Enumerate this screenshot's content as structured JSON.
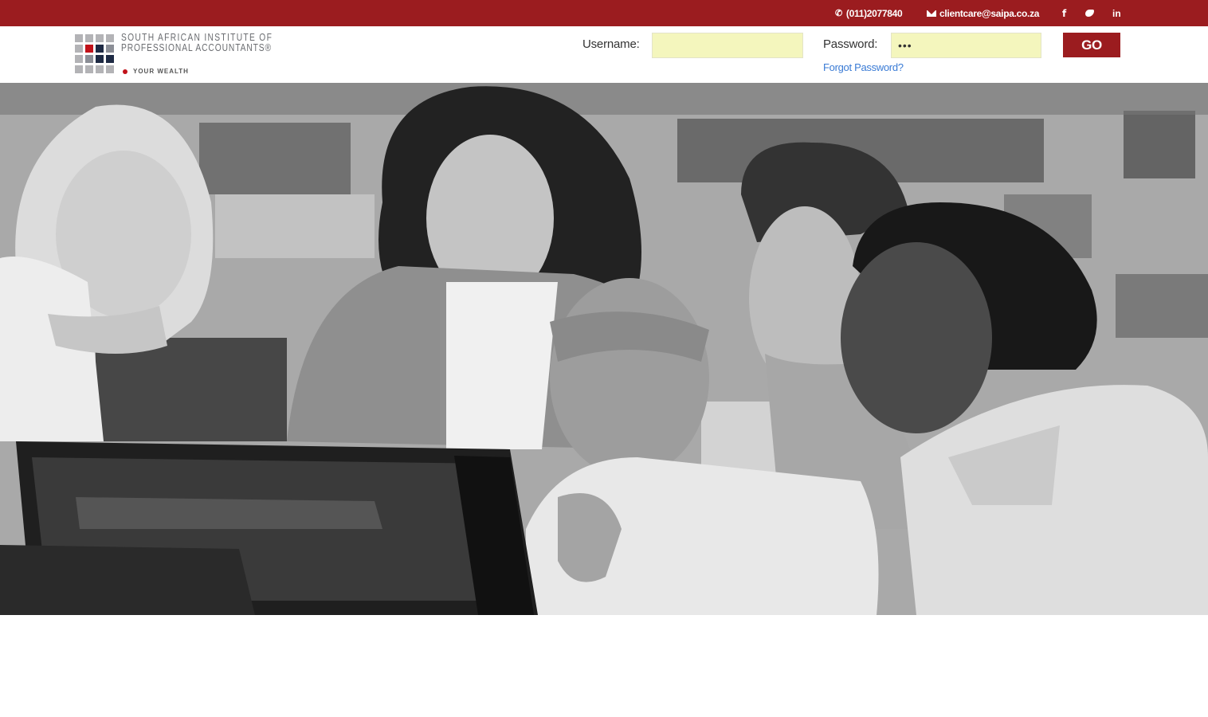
{
  "topbar": {
    "phone": "(011)2077840",
    "email": "clientcare@saipa.co.za",
    "social": {
      "facebook": "f",
      "linkedin": "in"
    },
    "color": "#9b1c1f"
  },
  "header": {
    "logo": {
      "line1": "SOUTH AFRICAN INSTITUTE OF",
      "line2": "PROFESSIONAL ACCOUNTANTS®",
      "tagline": "YOUR WEALTH"
    },
    "login": {
      "username_label": "Username:",
      "username_value": "",
      "password_label": "Password:",
      "password_value": "•••",
      "submit_label": "GO",
      "forgot_label": "Forgot Password?"
    }
  },
  "hero": {
    "icon": "team-photo-grayscale"
  }
}
